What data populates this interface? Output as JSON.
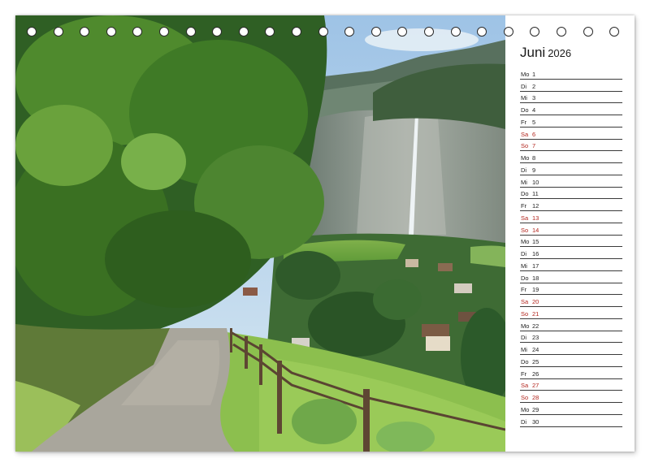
{
  "calendar": {
    "month": "Juni",
    "year": "2026",
    "days": [
      {
        "weekday": "Mo",
        "day": "1",
        "weekend": false
      },
      {
        "weekday": "Di",
        "day": "2",
        "weekend": false
      },
      {
        "weekday": "Mi",
        "day": "3",
        "weekend": false
      },
      {
        "weekday": "Do",
        "day": "4",
        "weekend": false
      },
      {
        "weekday": "Fr",
        "day": "5",
        "weekend": false
      },
      {
        "weekday": "Sa",
        "day": "6",
        "weekend": true
      },
      {
        "weekday": "So",
        "day": "7",
        "weekend": true
      },
      {
        "weekday": "Mo",
        "day": "8",
        "weekend": false
      },
      {
        "weekday": "Di",
        "day": "9",
        "weekend": false
      },
      {
        "weekday": "Mi",
        "day": "10",
        "weekend": false
      },
      {
        "weekday": "Do",
        "day": "11",
        "weekend": false
      },
      {
        "weekday": "Fr",
        "day": "12",
        "weekend": false
      },
      {
        "weekday": "Sa",
        "day": "13",
        "weekend": true
      },
      {
        "weekday": "So",
        "day": "14",
        "weekend": true
      },
      {
        "weekday": "Mo",
        "day": "15",
        "weekend": false
      },
      {
        "weekday": "Di",
        "day": "16",
        "weekend": false
      },
      {
        "weekday": "Mi",
        "day": "17",
        "weekend": false
      },
      {
        "weekday": "Do",
        "day": "18",
        "weekend": false
      },
      {
        "weekday": "Fr",
        "day": "19",
        "weekend": false
      },
      {
        "weekday": "Sa",
        "day": "20",
        "weekend": true
      },
      {
        "weekday": "So",
        "day": "21",
        "weekend": true
      },
      {
        "weekday": "Mo",
        "day": "22",
        "weekend": false
      },
      {
        "weekday": "Di",
        "day": "23",
        "weekend": false
      },
      {
        "weekday": "Mi",
        "day": "24",
        "weekend": false
      },
      {
        "weekday": "Do",
        "day": "25",
        "weekend": false
      },
      {
        "weekday": "Fr",
        "day": "26",
        "weekend": false
      },
      {
        "weekday": "Sa",
        "day": "27",
        "weekend": true
      },
      {
        "weekday": "So",
        "day": "28",
        "weekend": true
      },
      {
        "weekday": "Mo",
        "day": "29",
        "weekend": false
      },
      {
        "weekday": "Di",
        "day": "30",
        "weekend": false
      }
    ]
  },
  "colors": {
    "weekend_text": "#b3261e",
    "weekday_text": "#222222",
    "rule_line": "#3a3a3a",
    "binding_ring": "#2a2a2a"
  }
}
